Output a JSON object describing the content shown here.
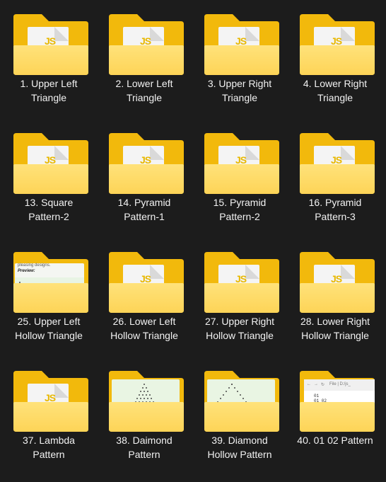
{
  "window": {
    "background": "#1c1c1c",
    "folder_color_back": "#f2b90c",
    "folder_color_front": "#fdd457",
    "text_color": "#f2f2f2"
  },
  "items": [
    {
      "line1": "1. Upper Left",
      "line2": "Triangle",
      "thumb": "js"
    },
    {
      "line1": "2. Lower Left",
      "line2": "Triangle",
      "thumb": "js"
    },
    {
      "line1": "3. Upper Right",
      "line2": "Triangle",
      "thumb": "js"
    },
    {
      "line1": "4. Lower Right",
      "line2": "Triangle",
      "thumb": "js"
    },
    {
      "line1": "13. Square",
      "line2": "Pattern-2",
      "thumb": "js"
    },
    {
      "line1": "14. Pyramid",
      "line2": "Pattern-1",
      "thumb": "js"
    },
    {
      "line1": "15. Pyramid",
      "line2": "Pattern-2",
      "thumb": "js"
    },
    {
      "line1": "16. Pyramid",
      "line2": "Pattern-3",
      "thumb": "js"
    },
    {
      "line1": "25. Upper Left",
      "line2": "Hollow Triangle",
      "thumb": "preview",
      "preview_line1": "pleasing designs.",
      "preview_line2": "Preview:"
    },
    {
      "line1": "26. Lower Left",
      "line2": "Hollow Triangle",
      "thumb": "js"
    },
    {
      "line1": "27. Upper Right",
      "line2": "Hollow Triangle",
      "thumb": "js"
    },
    {
      "line1": "28. Lower Right",
      "line2": "Hollow Triangle",
      "thumb": "js"
    },
    {
      "line1": "37. Lambda",
      "line2": "Pattern",
      "thumb": "js"
    },
    {
      "line1": "38. Daimond",
      "line2": "Pattern",
      "thumb": "diamond"
    },
    {
      "line1": "39. Diamond",
      "line2": "Hollow Pattern",
      "thumb": "hollow"
    },
    {
      "line1": "40. 01 02 Pattern",
      "line2": "",
      "thumb": "browser",
      "browser_text": "File | D:/js_",
      "code_line1": "01",
      "code_line2": "01 02"
    }
  ],
  "js_logo_text": "JS"
}
